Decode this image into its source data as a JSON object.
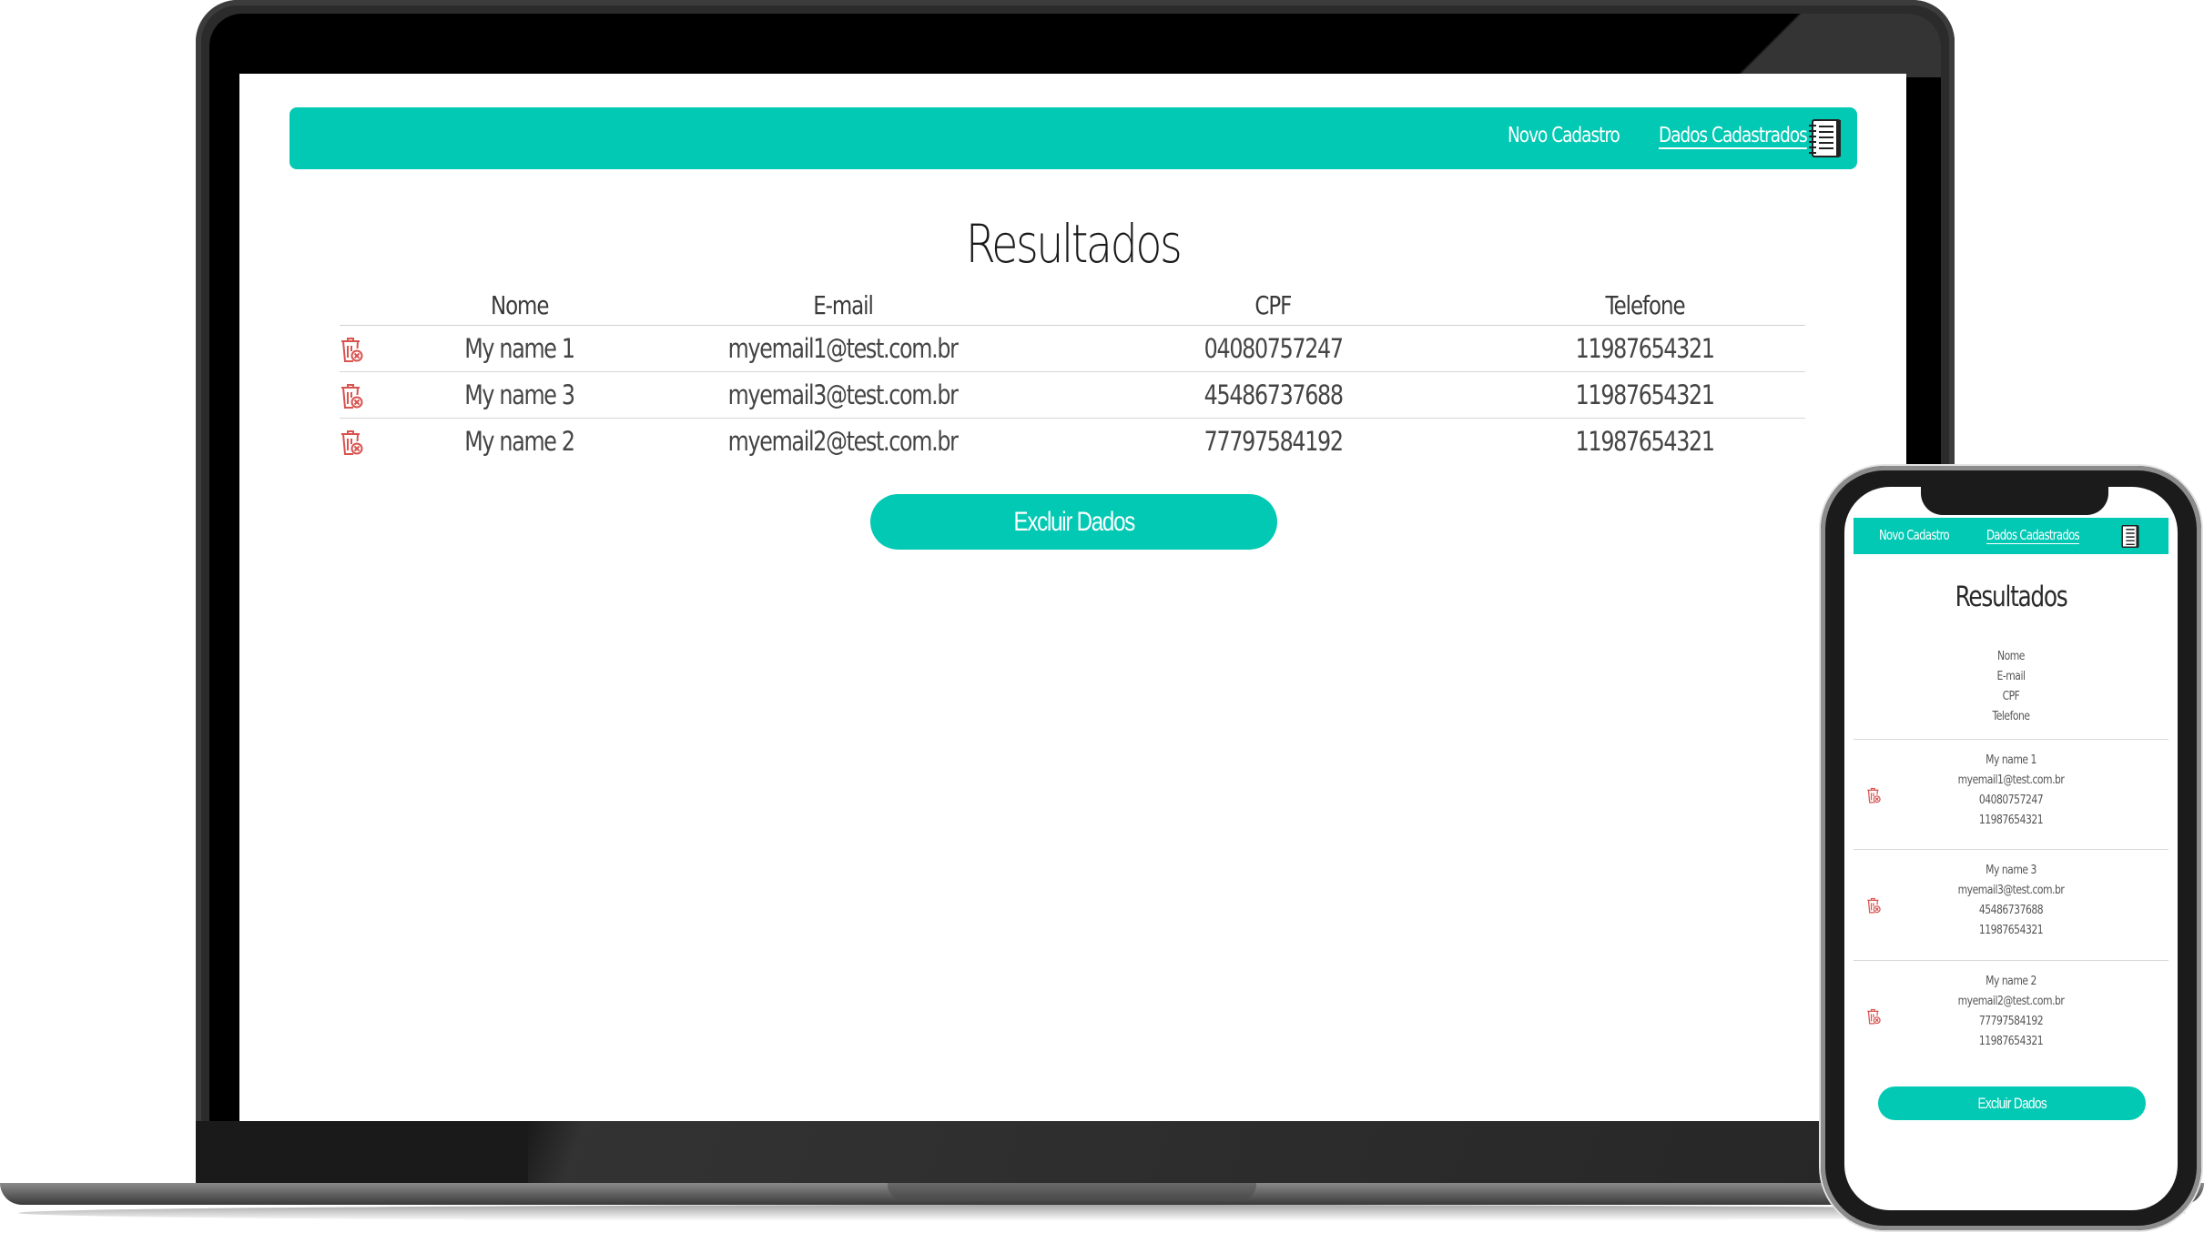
{
  "brand_color": "#02c9b4",
  "delete_icon_color": "#d9534f",
  "navbar": {
    "links": [
      {
        "label": "Novo Cadastro",
        "active": false
      },
      {
        "label": "Dados Cadastrados",
        "active": true
      }
    ],
    "icon": "notebook-icon"
  },
  "page": {
    "title": "Resultados",
    "columns": [
      "Nome",
      "E-mail",
      "CPF",
      "Telefone"
    ],
    "rows": [
      {
        "nome": "My name 1",
        "email": "myemail1@test.com.br",
        "cpf": "04080757247",
        "telefone": "11987654321"
      },
      {
        "nome": "My name 3",
        "email": "myemail3@test.com.br",
        "cpf": "45486737688",
        "telefone": "11987654321"
      },
      {
        "nome": "My name 2",
        "email": "myemail2@test.com.br",
        "cpf": "77797584192",
        "telefone": "11987654321"
      }
    ],
    "row_action_icon": "trash-icon",
    "delete_button_label": "Excluir Dados"
  }
}
